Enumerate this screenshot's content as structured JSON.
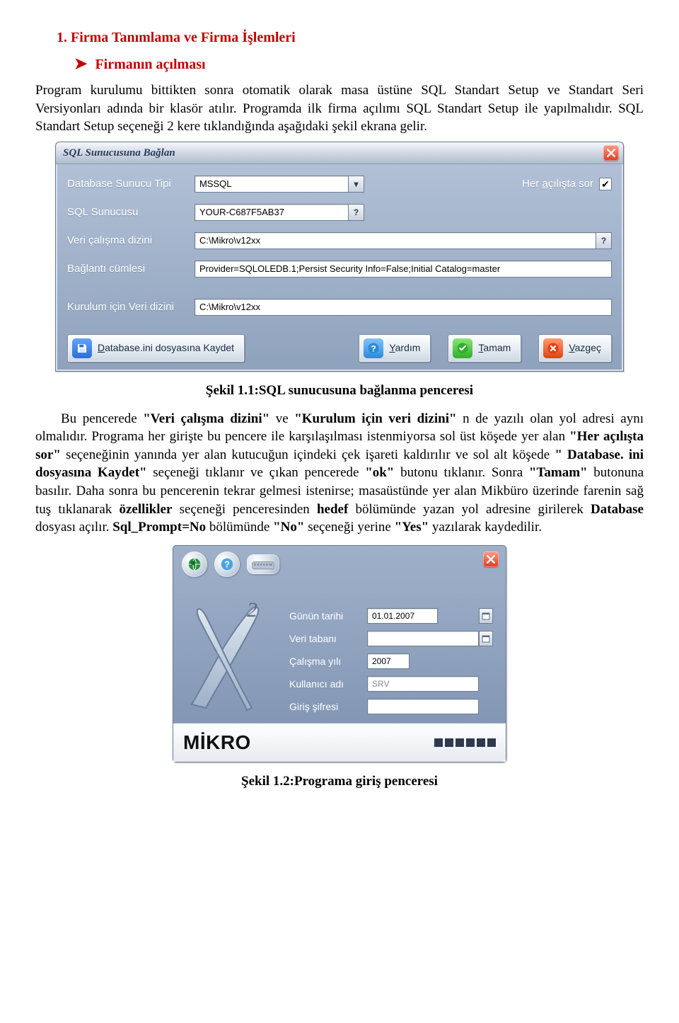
{
  "heading": "1. Firma Tanımlama ve Firma İşlemleri",
  "bullet": "Firmanın açılması",
  "para1": "Program kurulumu bittikten sonra otomatik olarak masa üstüne SQL Standart Setup ve Standart Seri Versiyonları adında bir klasör atılır. Programda ilk firma açılımı SQL Standart Setup ile yapılmalıdır. SQL Standart Setup seçeneği 2 kere tıklandığında aşağıdaki şekil ekrana gelir.",
  "dialog1": {
    "title": "SQL Sunucusuna Bağlan",
    "labels": {
      "sunucu_tipi": "Database Sunucu Tipi",
      "sql_sunucusu": "SQL Sunucusu",
      "veri_dizini": "Veri çalışma dizini",
      "baglanti": "Bağlantı cümlesi",
      "kurulum_dizini": "Kurulum için Veri dizini",
      "her_acilista": "Her açılışta sor"
    },
    "values": {
      "sunucu_tipi": "MSSQL",
      "sql_sunucusu": "YOUR-C687F5AB37",
      "veri_dizini": "C:\\Mikro\\v12xx",
      "baglanti": "Provider=SQLOLEDB.1;Persist Security Info=False;Initial Catalog=master",
      "kurulum_dizini": "C:\\Mikro\\v12xx"
    },
    "her_acilista_checked": true,
    "buttons": {
      "save_prefix": "D",
      "save_rest": "atabase.ini dosyasına Kaydet",
      "help_prefix": "Y",
      "help_rest": "ardım",
      "ok_prefix": "T",
      "ok_rest": "amam",
      "cancel_prefix": "V",
      "cancel_rest": "azgeç"
    }
  },
  "caption1": "Şekil 1.1:SQL sunucusuna bağlanma penceresi",
  "para2_parts": {
    "p1": "Bu pencerede ",
    "b1": "\"Veri çalışma dizini\"",
    "p2": " ve ",
    "b2": "\"Kurulum için veri dizini\"",
    "p3": " n de yazılı olan yol adresi aynı olmalıdır. Programa her girişte bu pencere ile karşılaşılması istenmiyorsa sol üst köşede yer alan ",
    "b3": "\"Her açılışta sor\"",
    "p4": " seçeneğinin yanında yer alan kutucuğun içindeki çek işareti kaldırılır ve sol alt köşede ",
    "b4": "\" Database. ini dosyasına Kaydet\"",
    "p5": " seçeneği tıklanır ve çıkan pencerede ",
    "b5": "\"ok\"",
    "p6": " butonu tıklanır. Sonra ",
    "b6": "\"Tamam\"",
    "p7": " butonuna basılır. Daha sonra bu pencerenin tekrar gelmesi istenirse; masaüstünde yer alan Mikbüro üzerinde farenin sağ tuş tıklanarak ",
    "b7": "özellikler",
    "p8": " seçeneği penceresinden ",
    "b8": "hedef",
    "p9": " bölümünde yazan yol adresine girilerek ",
    "b9": "Database",
    "p10": " dosyası açılır. ",
    "b10": "Sql_Prompt=No",
    "p11": " bölümünde ",
    "b11": "\"No\"",
    "p12": " seçeneği yerine ",
    "b12": "\"Yes\"",
    "p13": " yazılarak kaydedilir."
  },
  "login": {
    "labels": {
      "tarih": "Günün tarihi",
      "veritabani": "Veri tabanı",
      "calisma_yili": "Çalışma yılı",
      "kullanici": "Kullanıcı adı",
      "sifre": "Giriş şifresi"
    },
    "values": {
      "tarih": "01.01.2007",
      "veritabani": "",
      "calisma_yili": "2007",
      "kullanici": "SRV",
      "sifre": ""
    },
    "logo_text": "MİKRO"
  },
  "caption2": "Şekil 1.2:Programa giriş penceresi"
}
